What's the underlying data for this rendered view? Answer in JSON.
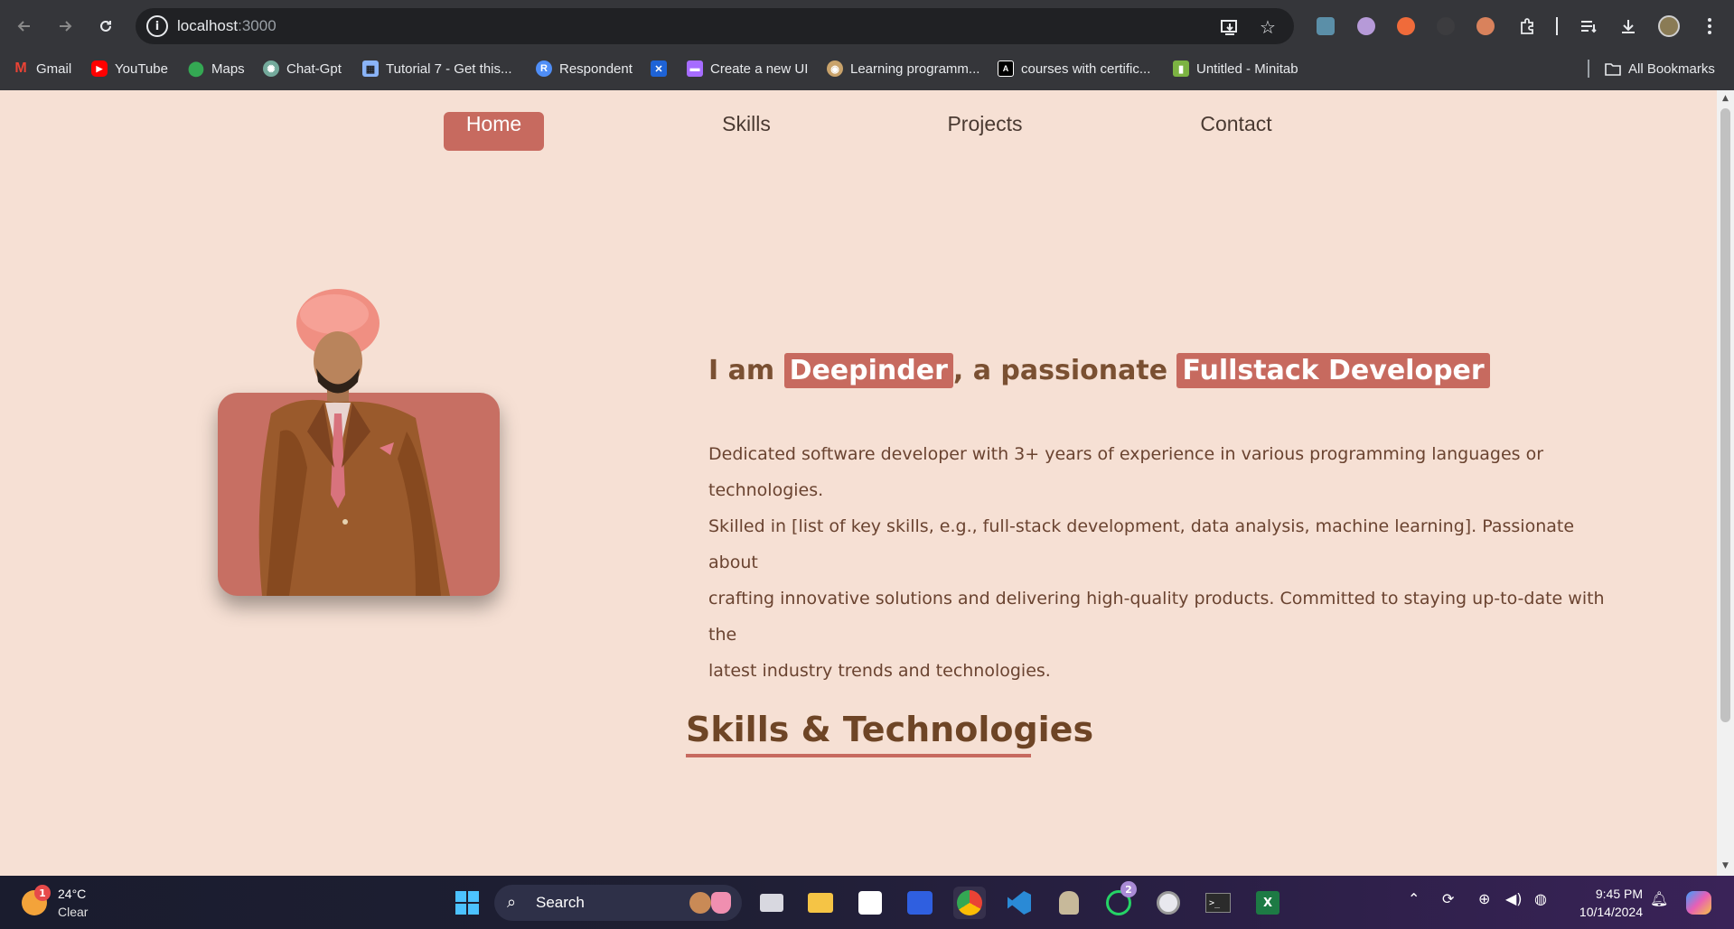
{
  "browser": {
    "url_host": "localhost",
    "url_port": ":3000",
    "bookmarks": [
      {
        "label": "Gmail",
        "icon": "gmail-icon",
        "color": "#ea4335"
      },
      {
        "label": "YouTube",
        "icon": "youtube-icon",
        "color": "#ff0000"
      },
      {
        "label": "Maps",
        "icon": "maps-icon",
        "color": "#34a853"
      },
      {
        "label": "Chat-Gpt",
        "icon": "chatgpt-icon",
        "color": "#74aa9c"
      },
      {
        "label": "Tutorial 7 - Get this...",
        "icon": "document-icon",
        "color": "#8ab4f8"
      },
      {
        "label": "Respondent",
        "icon": "respondent-icon",
        "color": "#4f8ef7"
      },
      {
        "label": "Create a new UI",
        "icon": "ui-icon",
        "color": "#a66cff"
      },
      {
        "label": "Learning programm...",
        "icon": "owl-icon",
        "color": "#c9a36b"
      },
      {
        "label": "courses with certific...",
        "icon": "code-icon",
        "color": "#ffffff"
      },
      {
        "label": "Untitled - Minitab",
        "icon": "minitab-icon",
        "color": "#7cb342"
      }
    ],
    "all_bookmarks": "All Bookmarks"
  },
  "nav": {
    "home": "Home",
    "skills": "Skills",
    "projects": "Projects",
    "contact": "Contact"
  },
  "hero": {
    "intro_prefix": "I am ",
    "name": "Deepinder",
    "intro_middle": ", a passionate ",
    "role": "Fullstack Developer",
    "bio_lines": [
      "Dedicated software developer with 3+ years of experience in various programming languages or technologies.",
      "Skilled in [list of key skills, e.g., full-stack development, data analysis, machine learning]. Passionate about",
      "crafting innovative solutions and delivering high-quality products. Committed to staying up-to-date with the",
      "latest industry trends and technologies."
    ]
  },
  "skills_section": {
    "title": "Skills & Technologies"
  },
  "colors": {
    "accent": "#c76a5f",
    "page_bg": "#f6e0d4",
    "text_brown": "#7a5032"
  },
  "taskbar": {
    "weather_temp": "24°C",
    "weather_condition": "Clear",
    "weather_badge": "1",
    "search_label": "Search",
    "whatsapp_badge": "2",
    "time": "9:45 PM",
    "date": "10/14/2024"
  }
}
